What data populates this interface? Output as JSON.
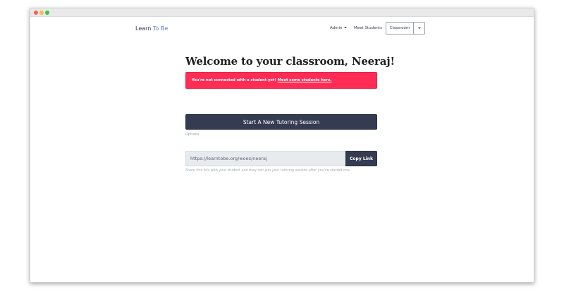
{
  "window": {
    "controls": [
      "close",
      "minimize",
      "maximize"
    ]
  },
  "nav": {
    "brand_main": "Learn",
    "brand_accent": " To Be",
    "admin_label": "Admin",
    "meet_students_label": "Meet Students",
    "classroom_label": "Classroom"
  },
  "main": {
    "title": "Welcome to your classroom, Neeraj!",
    "alert_text": "You're not connected with a student yet!",
    "alert_link": "Meet some students here.",
    "start_button": "Start A New Tutoring Session",
    "options_label": "Options",
    "link_value": "https://learntobe.org/woes/neeraj",
    "copy_button": "Copy Link",
    "help_text": "Share this link with your student and they can join your tutoring session after you've started one."
  },
  "colors": {
    "alert": "#ff2d55",
    "primary_dark": "#353c52",
    "brand_accent": "#5c7ccf"
  }
}
